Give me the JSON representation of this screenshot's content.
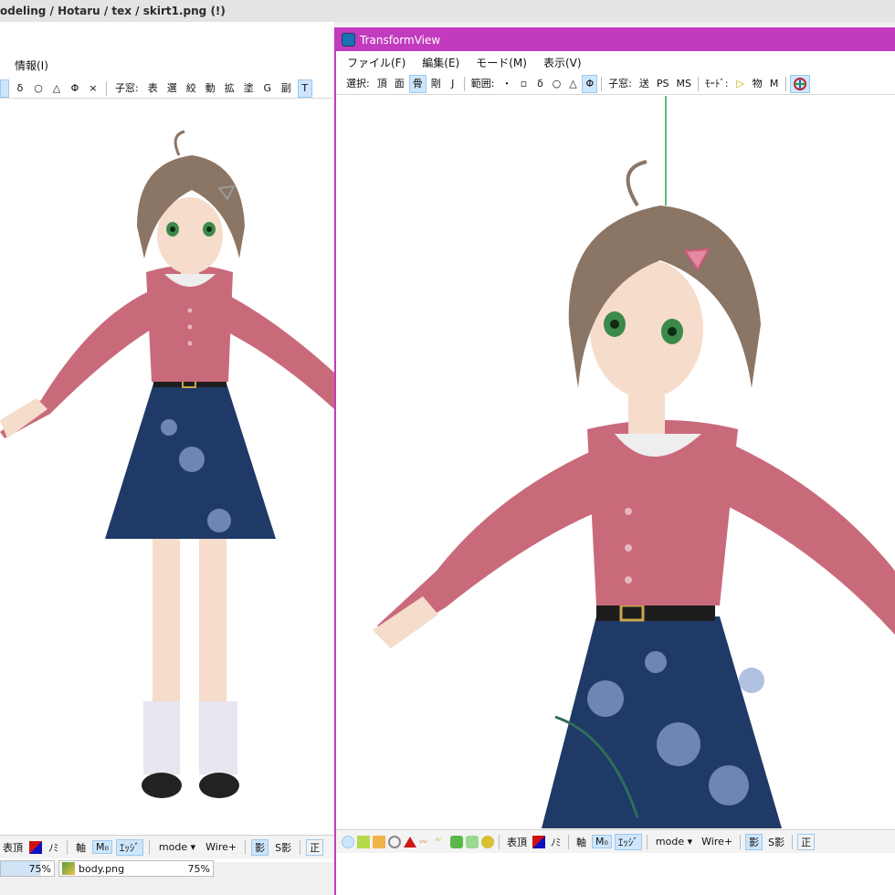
{
  "left_window": {
    "title": "odeling / Hotaru / tex / skirt1.png (!)",
    "menu": [
      "情報(I)"
    ],
    "toolbar": [
      "δ",
      "○",
      "△",
      "Φ",
      "×",
      "子窓:",
      "表",
      "選",
      "絞",
      "動",
      "拡",
      "塗",
      "G",
      "副",
      "T"
    ],
    "toolbar_active": "T",
    "bottombar": {
      "items": [
        "表頂",
        "ﾉﾐ",
        "軸",
        "ｴｯｼﾞ",
        "mode",
        "Wire+",
        "影",
        "S影",
        "正"
      ],
      "mode_label": "mode",
      "wire_label": "Wire+"
    }
  },
  "status_strip": {
    "zoom_left": "75%",
    "file_name": "body.png",
    "zoom_right": "75%"
  },
  "transform_view": {
    "title": "TransformView",
    "menu": [
      "ファイル(F)",
      "編集(E)",
      "モード(M)",
      "表示(V)"
    ],
    "toolbar": {
      "select_label": "選択:",
      "select_items": [
        "頂",
        "面",
        "骨",
        "剛",
        "J"
      ],
      "select_active": "骨",
      "range_label": "範囲:",
      "range_items": [
        "・",
        "▫",
        "δ",
        "○",
        "△",
        "Φ"
      ],
      "range_active": "Φ",
      "child_label": "子窓:",
      "child_items": [
        "送",
        "PS",
        "MS"
      ],
      "mode_label": "ﾓｰﾄﾞ:",
      "mode_items": [
        "▷",
        "物",
        "M"
      ]
    },
    "bottombar": {
      "items": [
        "表頂",
        "ﾉﾐ",
        "軸",
        "ｴｯｼﾞ",
        "mode",
        "Wire+",
        "影",
        "S影",
        "正"
      ],
      "mode_label": "mode",
      "wire_label": "Wire+"
    }
  },
  "colors": {
    "tv_titlebar": "#c23bbf",
    "sweater": "#c96a7b",
    "skirt": "#1f3a66",
    "hair": "#8b7565"
  },
  "icons": [
    "app-icon",
    "caret-down-icon",
    "color-swatch-icon",
    "axis-icon",
    "sphere-icon",
    "cube-icon"
  ]
}
